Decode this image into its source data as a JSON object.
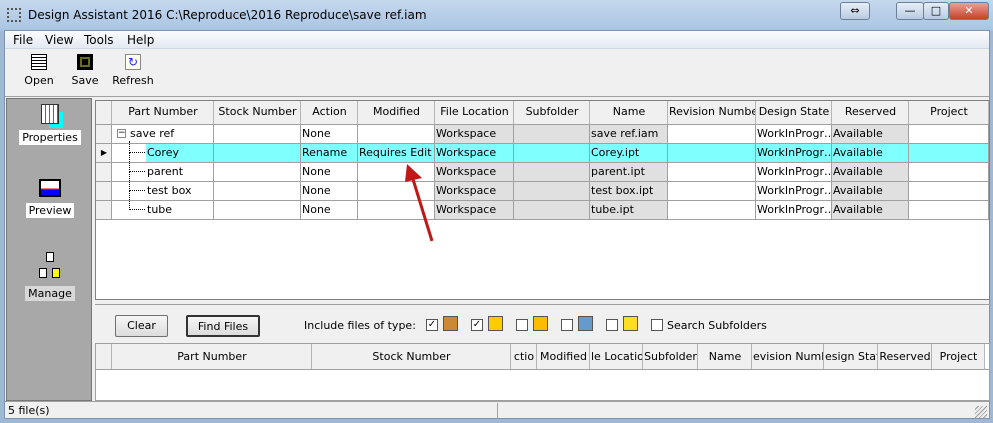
{
  "window": {
    "title": "Design Assistant 2016 C:\\Reproduce\\2016 Reproduce\\save ref.iam",
    "controls": [
      "⇔",
      "—",
      "□",
      "✕"
    ]
  },
  "menu": [
    "File",
    "View",
    "Tools",
    "Help"
  ],
  "toolbar": {
    "open": "Open",
    "save": "Save",
    "refresh": "Refresh"
  },
  "sidebar": {
    "properties": "Properties",
    "preview": "Preview",
    "manage": "Manage"
  },
  "grid": {
    "headers": [
      "Part Number",
      "Stock Number",
      "Action",
      "Modified",
      "File Location",
      "Subfolder",
      "Name",
      "Revision Number",
      "Design State",
      "Reserved",
      "Project"
    ],
    "rows": [
      {
        "part": "save ref",
        "stock": "",
        "action": "None",
        "modified": "",
        "location": "Workspace",
        "subfolder": "",
        "name": "save ref.iam",
        "revision": "",
        "state": "WorkInProgr…",
        "reserved": "Available",
        "project": ""
      },
      {
        "part": "Corey",
        "stock": "",
        "action": "Rename",
        "modified": "Requires Edit",
        "location": "Workspace",
        "subfolder": "",
        "name": "Corey.ipt",
        "revision": "",
        "state": "WorkInProgr…",
        "reserved": "Available",
        "project": ""
      },
      {
        "part": "parent",
        "stock": "",
        "action": "None",
        "modified": "",
        "location": "Workspace",
        "subfolder": "",
        "name": "parent.ipt",
        "revision": "",
        "state": "WorkInProgr…",
        "reserved": "Available",
        "project": ""
      },
      {
        "part": "test box",
        "stock": "",
        "action": "None",
        "modified": "",
        "location": "Workspace",
        "subfolder": "",
        "name": "test box.ipt",
        "revision": "",
        "state": "WorkInProgr…",
        "reserved": "Available",
        "project": ""
      },
      {
        "part": "tube",
        "stock": "",
        "action": "None",
        "modified": "",
        "location": "Workspace",
        "subfolder": "",
        "name": "tube.ipt",
        "revision": "",
        "state": "WorkInProgr…",
        "reserved": "Available",
        "project": ""
      }
    ],
    "selected_row": 1,
    "highlight": "#80ffff"
  },
  "search": {
    "clear": "Clear",
    "find": "Find Files",
    "include_label": "Include files of type:",
    "filetypes": [
      {
        "icon": "assembly-icon",
        "checked": true
      },
      {
        "icon": "drawing-icon",
        "checked": true
      },
      {
        "icon": "presentation-icon",
        "checked": false
      },
      {
        "icon": "weldment-icon",
        "checked": false
      },
      {
        "icon": "part-icon",
        "checked": false
      }
    ],
    "search_subfolders": "Search Subfolders",
    "search_subfolders_checked": false,
    "headers": [
      "Part Number",
      "Stock Number",
      "ctio",
      "Modified",
      "le Locatio",
      "Subfolder",
      "Name",
      "evision Numbe",
      "esign Stat",
      "Reserved",
      "Project"
    ]
  },
  "status": {
    "text": "5 file(s)"
  }
}
